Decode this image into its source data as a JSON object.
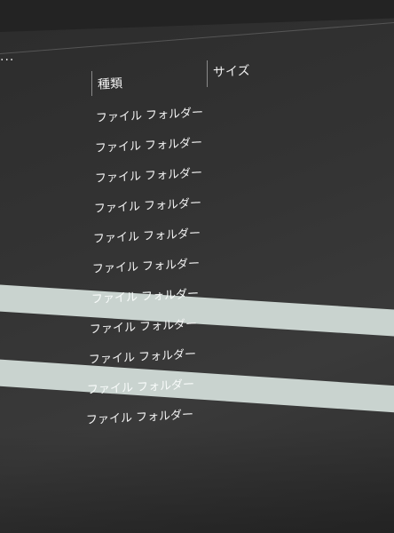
{
  "toolbar": {
    "overflow_label": "..."
  },
  "columns": [
    {
      "label": "種類"
    },
    {
      "label": "サイズ"
    }
  ],
  "rows": [
    {
      "type": "ファイル フォルダー",
      "selected": false
    },
    {
      "type": "ファイル フォルダー",
      "selected": false
    },
    {
      "type": "ファイル フォルダー",
      "selected": false
    },
    {
      "type": "ファイル フォルダー",
      "selected": false
    },
    {
      "type": "ファイル フォルダー",
      "selected": false
    },
    {
      "type": "ファイル フォルダー",
      "selected": false
    },
    {
      "type": "ファイル フォルダー",
      "selected": true
    },
    {
      "type": "ファイル フォルダー",
      "selected": false
    },
    {
      "type": "ファイル フォルダー",
      "selected": false
    },
    {
      "type": "ファイル フォルダー",
      "selected": true
    },
    {
      "type": "ファイル フォルダー",
      "selected": false
    }
  ],
  "colors": {
    "background": "#333333",
    "selection": "#c9d3cf",
    "text": "#f2f2f2"
  }
}
